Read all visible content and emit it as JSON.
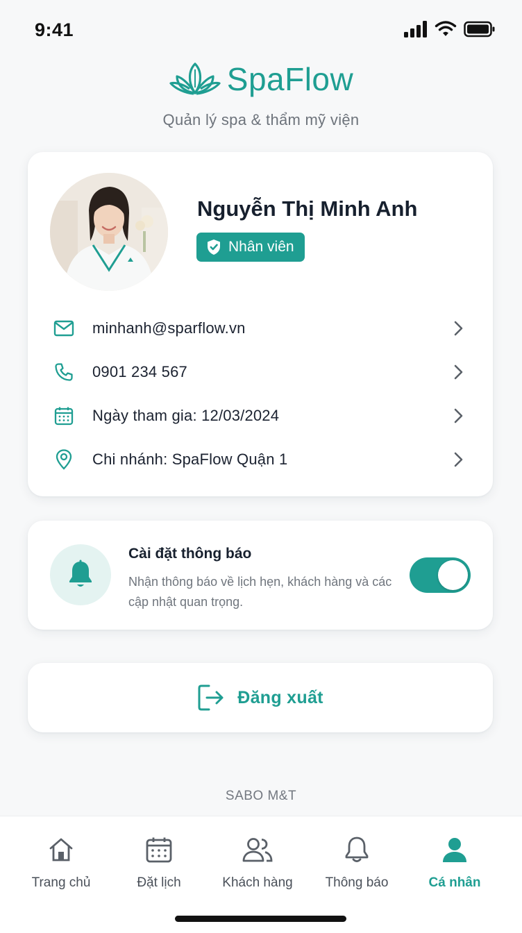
{
  "status_bar": {
    "time": "9:41",
    "icons": [
      "signal-icon",
      "wifi-icon",
      "battery-icon"
    ]
  },
  "brand": {
    "name": "SpaFlow",
    "tagline": "Quản lý spa & thẩm mỹ viện",
    "logo_icon": "lotus-icon"
  },
  "profile": {
    "name": "Nguyễn Thị Minh Anh",
    "role": "Nhân viên",
    "role_icon": "shield-check-icon",
    "avatar_alt": "avatar",
    "info": [
      {
        "icon": "mail-icon",
        "text": "minhanh@sparflow.vn"
      },
      {
        "icon": "phone-icon",
        "text": "0901 234 567"
      },
      {
        "icon": "calendar-icon",
        "text": "Ngày tham gia: 12/03/2024"
      },
      {
        "icon": "location-pin-icon",
        "text": "Chi nhánh: SpaFlow Quận 1"
      }
    ]
  },
  "notification_settings": {
    "title": "Cài đặt thông báo",
    "description": "Nhận thông báo về lịch hẹn, khách hàng và các cập nhật quan trọng.",
    "enabled": true,
    "icon": "bell-icon"
  },
  "logout": {
    "label": "Đăng xuất",
    "icon": "logout-icon"
  },
  "footer": {
    "text": "SABO M&T"
  },
  "tab_bar": {
    "tabs": [
      {
        "label": "Trang chủ",
        "icon": "home-icon",
        "active": false
      },
      {
        "label": "Đặt lịch",
        "icon": "calendar-icon",
        "active": false
      },
      {
        "label": "Khách hàng",
        "icon": "users-icon",
        "active": false
      },
      {
        "label": "Thông báo",
        "icon": "bell-icon",
        "active": false
      },
      {
        "label": "Cá nhân",
        "icon": "user-icon",
        "active": true
      }
    ]
  },
  "colors": {
    "accent": "#1f9e92",
    "accent_light": "#e4f3f1",
    "background": "#f7f8f9"
  }
}
